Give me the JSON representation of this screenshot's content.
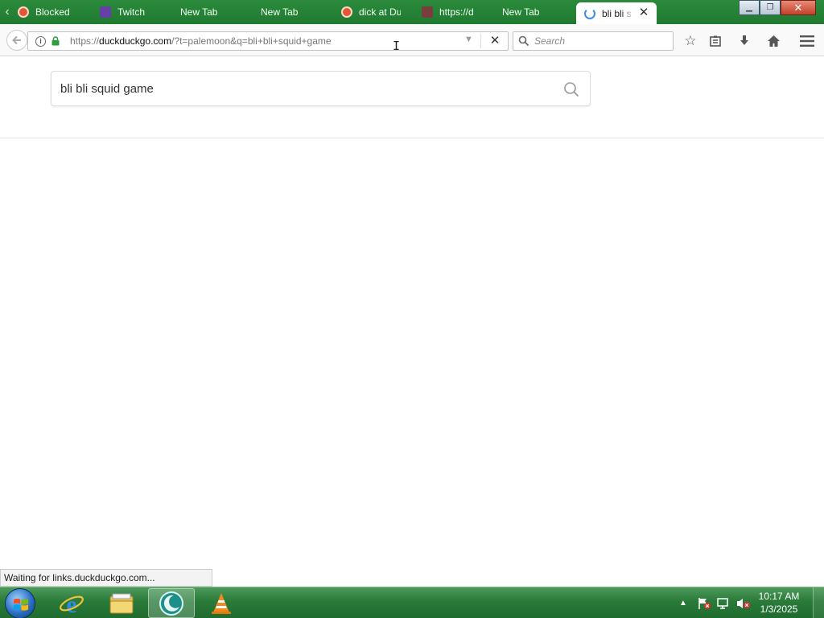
{
  "browser": {
    "tabs": [
      {
        "label": "Blocked",
        "icon": "duckduckgo-favicon"
      },
      {
        "label": "Twitch",
        "icon": "twitch-favicon"
      },
      {
        "label": "New Tab",
        "icon": ""
      },
      {
        "label": "New Tab",
        "icon": ""
      },
      {
        "label": "dick at Du",
        "icon": "duckduckgo-favicon"
      },
      {
        "label": "https://d",
        "icon": "web-favicon"
      },
      {
        "label": "New Tab",
        "icon": ""
      },
      {
        "label": "bli bli s",
        "icon": "loading-spinner-icon",
        "active": true
      }
    ],
    "url": {
      "prefix": "https://",
      "domain": "duckduckgo.com",
      "path": "/?t=palemoon&q=bli+bli+squid+game"
    },
    "search_placeholder": "Search"
  },
  "page": {
    "query": "bli bli squid game"
  },
  "status_text": "Waiting for links.duckduckgo.com...",
  "taskbar": {
    "time": "10:17 AM",
    "date": "1/3/2025"
  },
  "colors": {
    "titlebar": "#2b8a3b",
    "taskbar": "#2a7a3a",
    "accent_blue": "#3a8fe6"
  }
}
